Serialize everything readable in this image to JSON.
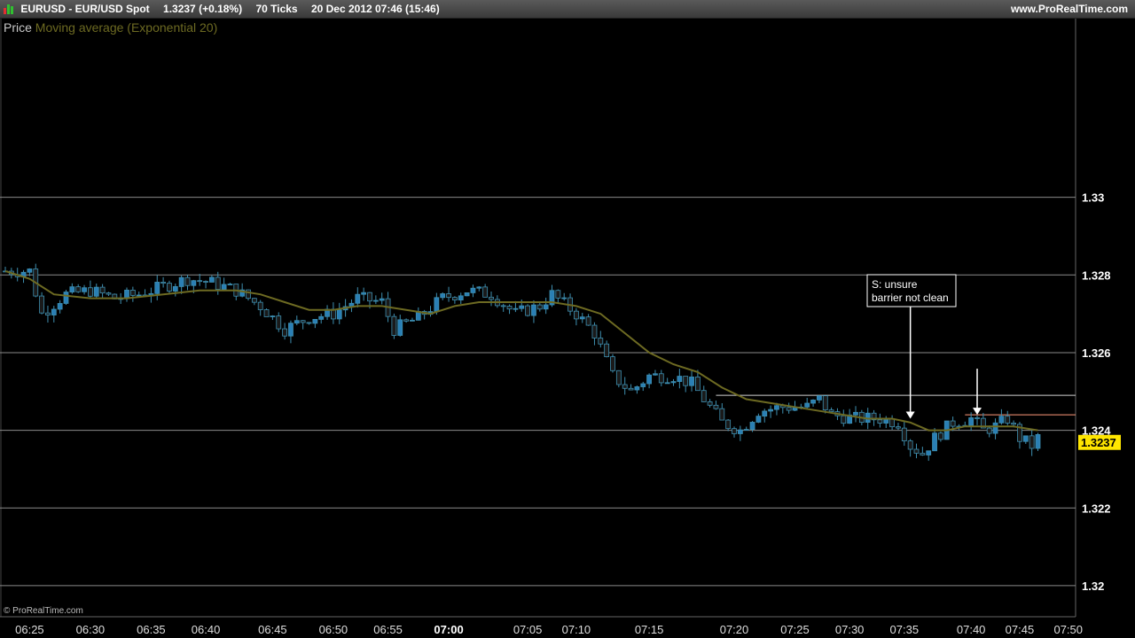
{
  "header": {
    "symbol": "EURUSD - EUR/USD Spot",
    "last": "1.3237 (+0.18%)",
    "ticks": "70 Ticks",
    "datetime": "20 Dec 2012 07:46 (15:46)",
    "site": "www.ProRealTime.com"
  },
  "legend": {
    "price": "Price",
    "ma": "Moving average (Exponential 20)"
  },
  "copyright": "© ProRealTime.com",
  "colors": {
    "up": "#2a7fb5",
    "down": "#1a1a1a",
    "wick": "#3e8fb0",
    "ma": "#6d6a22",
    "grid": "#8a8a8a",
    "last_bg": "#ffe600"
  },
  "chart_data": {
    "type": "candlestick",
    "ylim": [
      1.3192,
      1.3346
    ],
    "yticks": [
      1.33,
      1.328,
      1.326,
      1.324,
      1.322,
      1.32
    ],
    "ytick_labels": [
      "1.33",
      "1.328",
      "1.326",
      "1.324",
      "1.322",
      "1.32"
    ],
    "last_price": 1.3237,
    "last_price_label": "1.3237",
    "xticks": [
      {
        "label": "06:25",
        "bar": 4
      },
      {
        "label": "06:30",
        "bar": 14
      },
      {
        "label": "06:35",
        "bar": 24
      },
      {
        "label": "06:40",
        "bar": 33
      },
      {
        "label": "06:45",
        "bar": 44
      },
      {
        "label": "06:50",
        "bar": 54
      },
      {
        "label": "06:55",
        "bar": 63
      },
      {
        "label": "07:00",
        "bar": 73,
        "bold": true
      },
      {
        "label": "07:05",
        "bar": 86
      },
      {
        "label": "07:10",
        "bar": 94
      },
      {
        "label": "07:15",
        "bar": 106
      },
      {
        "label": "07:20",
        "bar": 120
      },
      {
        "label": "07:25",
        "bar": 130
      },
      {
        "label": "07:30",
        "bar": 139
      },
      {
        "label": "07:35",
        "bar": 148
      },
      {
        "label": "07:40",
        "bar": 159
      },
      {
        "label": "07:45",
        "bar": 167
      },
      {
        "label": "07:50",
        "bar": 175
      }
    ],
    "price_path": [
      [
        0,
        1.3281
      ],
      [
        4,
        1.3281
      ],
      [
        6,
        1.327
      ],
      [
        10,
        1.3275
      ],
      [
        14,
        1.3276
      ],
      [
        18,
        1.3274
      ],
      [
        22,
        1.3275
      ],
      [
        26,
        1.3277
      ],
      [
        30,
        1.3279
      ],
      [
        34,
        1.3278
      ],
      [
        38,
        1.3276
      ],
      [
        42,
        1.3272
      ],
      [
        46,
        1.3266
      ],
      [
        50,
        1.3269
      ],
      [
        54,
        1.327
      ],
      [
        58,
        1.3274
      ],
      [
        62,
        1.3273
      ],
      [
        64,
        1.3266
      ],
      [
        68,
        1.3269
      ],
      [
        72,
        1.3274
      ],
      [
        76,
        1.3276
      ],
      [
        80,
        1.3275
      ],
      [
        84,
        1.327
      ],
      [
        88,
        1.3272
      ],
      [
        90,
        1.3275
      ],
      [
        94,
        1.327
      ],
      [
        97,
        1.3265
      ],
      [
        100,
        1.3254
      ],
      [
        103,
        1.325
      ],
      [
        106,
        1.3254
      ],
      [
        110,
        1.3254
      ],
      [
        113,
        1.3252
      ],
      [
        116,
        1.3246
      ],
      [
        118,
        1.3242
      ],
      [
        121,
        1.324
      ],
      [
        124,
        1.3245
      ],
      [
        128,
        1.3246
      ],
      [
        132,
        1.3246
      ],
      [
        134,
        1.3248
      ],
      [
        136,
        1.3244
      ],
      [
        140,
        1.3243
      ],
      [
        144,
        1.3243
      ],
      [
        147,
        1.3242
      ],
      [
        149,
        1.3236
      ],
      [
        151,
        1.3234
      ],
      [
        153,
        1.3238
      ],
      [
        156,
        1.3242
      ],
      [
        159,
        1.3243
      ],
      [
        161,
        1.324
      ],
      [
        163,
        1.3241
      ],
      [
        165,
        1.3243
      ],
      [
        167,
        1.3238
      ],
      [
        169,
        1.3236
      ],
      [
        170,
        1.3238
      ]
    ],
    "ma_path": [
      [
        0,
        1.3281
      ],
      [
        4,
        1.3279
      ],
      [
        8,
        1.3275
      ],
      [
        14,
        1.3274
      ],
      [
        20,
        1.3274
      ],
      [
        26,
        1.3275
      ],
      [
        32,
        1.3276
      ],
      [
        38,
        1.3276
      ],
      [
        42,
        1.3275
      ],
      [
        46,
        1.3273
      ],
      [
        50,
        1.3271
      ],
      [
        54,
        1.3271
      ],
      [
        58,
        1.3272
      ],
      [
        62,
        1.3272
      ],
      [
        66,
        1.3271
      ],
      [
        70,
        1.327
      ],
      [
        74,
        1.3272
      ],
      [
        78,
        1.3273
      ],
      [
        82,
        1.3273
      ],
      [
        86,
        1.3273
      ],
      [
        90,
        1.3273
      ],
      [
        94,
        1.3272
      ],
      [
        98,
        1.327
      ],
      [
        102,
        1.3265
      ],
      [
        106,
        1.326
      ],
      [
        110,
        1.3257
      ],
      [
        114,
        1.3255
      ],
      [
        118,
        1.3251
      ],
      [
        122,
        1.3248
      ],
      [
        126,
        1.3247
      ],
      [
        130,
        1.3246
      ],
      [
        134,
        1.3245
      ],
      [
        138,
        1.3244
      ],
      [
        142,
        1.3243
      ],
      [
        146,
        1.3243
      ],
      [
        149,
        1.3242
      ],
      [
        152,
        1.324
      ],
      [
        155,
        1.324
      ],
      [
        158,
        1.3241
      ],
      [
        162,
        1.3241
      ],
      [
        166,
        1.3241
      ],
      [
        170,
        1.324
      ]
    ],
    "hlines": [
      {
        "value": 1.3249,
        "from_bar": 117,
        "color": "#cfcfcf"
      },
      {
        "value": 1.3244,
        "from_bar": 158,
        "color": "#ff9a7a"
      }
    ],
    "annotation": {
      "line1": "S: unsure",
      "line2": "barrier not clean"
    },
    "arrows": [
      {
        "bar": 149,
        "value": 1.3243
      },
      {
        "bar": 160,
        "value": 1.3244
      }
    ]
  }
}
